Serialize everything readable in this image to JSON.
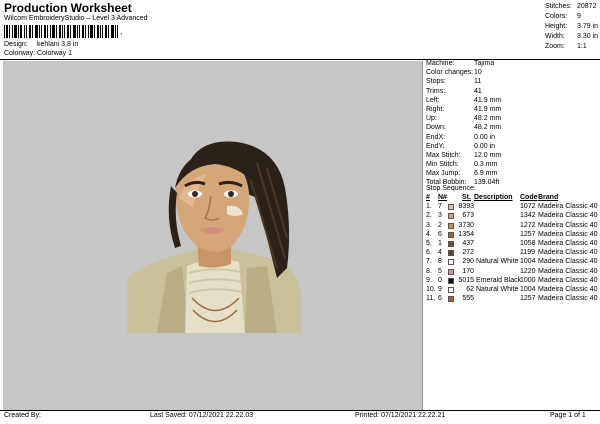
{
  "header": {
    "title": "Production Worksheet",
    "subtitle": "Wilcom EmbroideryStudio – Level 3 Advanced",
    "barcode_text": ",",
    "design_label": "Design:",
    "design_value": "kehlani 3,8 in",
    "colorway_label": "Colorway:",
    "colorway_value": "Colorway 1"
  },
  "summary": [
    {
      "label": "Stitches:",
      "value": "20872"
    },
    {
      "label": "Colors:",
      "value": "9"
    },
    {
      "label": "Height:",
      "value": "3.79 in"
    },
    {
      "label": "Width:",
      "value": "3.30 in"
    },
    {
      "label": "Zoom:",
      "value": "1:1"
    }
  ],
  "details": [
    {
      "label": "Machine:",
      "value": "Tajima"
    },
    {
      "label": "Color changes:",
      "value": "10"
    },
    {
      "label": "Stops:",
      "value": "11"
    },
    {
      "label": "Trims:",
      "value": "41"
    },
    {
      "label": "Left:",
      "value": "41.9 mm"
    },
    {
      "label": "Right:",
      "value": "41.9 mm"
    },
    {
      "label": "Up:",
      "value": "48.2 mm"
    },
    {
      "label": "Down:",
      "value": "48.2 mm"
    },
    {
      "label": "EndX:",
      "value": "0.00 in"
    },
    {
      "label": "EndY:",
      "value": "0.00 in"
    },
    {
      "label": "Max Stitch:",
      "value": "12.0 mm"
    },
    {
      "label": "Min Stitch:",
      "value": "0.3 mm"
    },
    {
      "label": "Max Jump:",
      "value": "6.9 mm"
    },
    {
      "label": "Total Bobbin:",
      "value": "139.04ft"
    }
  ],
  "stop_sequence": {
    "title": "Stop Sequence:",
    "headers": {
      "n": "#",
      "num": "N#",
      "st": "St.",
      "desc": "Description",
      "code": "Code",
      "brand": "Brand"
    },
    "rows": [
      {
        "n": "1.",
        "num": "7",
        "color": "#e3c2a2",
        "st": "8393",
        "desc": "",
        "code": "1072",
        "brand": "Madeira Classic 40"
      },
      {
        "n": "2.",
        "num": "3",
        "color": "#d7a47a",
        "st": "673",
        "desc": "",
        "code": "1342",
        "brand": "Madeira Classic 40"
      },
      {
        "n": "3.",
        "num": "2",
        "color": "#c98a5c",
        "st": "3730",
        "desc": "",
        "code": "1272",
        "brand": "Madeira Classic 40"
      },
      {
        "n": "4.",
        "num": "6",
        "color": "#b0622f",
        "st": "1354",
        "desc": "",
        "code": "1257",
        "brand": "Madeira Classic 40"
      },
      {
        "n": "5.",
        "num": "1",
        "color": "#7a4a2c",
        "st": "437",
        "desc": "",
        "code": "1058",
        "brand": "Madeira Classic 40"
      },
      {
        "n": "6.",
        "num": "4",
        "color": "#54402e",
        "st": "272",
        "desc": "",
        "code": "1199",
        "brand": "Madeira Classic 40"
      },
      {
        "n": "7.",
        "num": "8",
        "color": "#ffffff",
        "st": "290",
        "desc": "Natural White",
        "code": "1004",
        "brand": "Madeira Classic 40"
      },
      {
        "n": "8.",
        "num": "5",
        "color": "#e58e8a",
        "st": "170",
        "desc": "",
        "code": "1220",
        "brand": "Madeira Classic 40"
      },
      {
        "n": "9.",
        "num": "0",
        "color": "#111111",
        "st": "5015",
        "desc": "Emerald Black",
        "code": "1000",
        "brand": "Madeira Classic 40"
      },
      {
        "n": "10.",
        "num": "9",
        "color": "#ffffff",
        "st": "62",
        "desc": "Natural White",
        "code": "1004",
        "brand": "Madeira Classic 40"
      },
      {
        "n": "11.",
        "num": "6",
        "color": "#b0622f",
        "st": "555",
        "desc": "",
        "code": "1257",
        "brand": "Madeira Classic 40"
      }
    ]
  },
  "footer": {
    "created_by": "Created By:",
    "last_saved": "Last Saved: 07/12/2021 22.22.03",
    "printed": "Printed: 07/12/2021 22.22.21",
    "page": "Page 1 of 1"
  }
}
